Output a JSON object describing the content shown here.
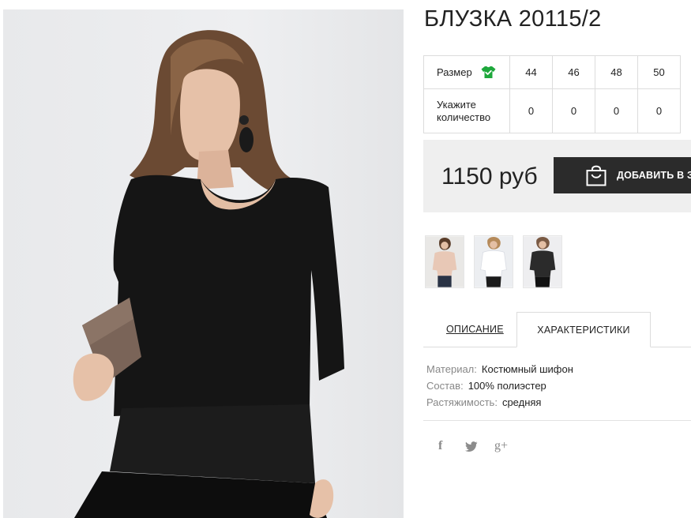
{
  "product": {
    "title": "БЛУЗКА 20115/2",
    "photo_alt": "Black blouse product photo"
  },
  "size_table": {
    "size_label": "Размер",
    "qty_label_line1": "Укажите",
    "qty_label_line2": "количество",
    "sizes": [
      "44",
      "46",
      "48",
      "50"
    ],
    "quantities": [
      "0",
      "0",
      "0",
      "0"
    ],
    "icon": "shirt-check-icon",
    "icon_color": "#1ea83c"
  },
  "purchase": {
    "price": "1150 руб",
    "add_to_cart_label": "ДОБАВИТЬ В ЗА",
    "button_color": "#2b2b2b"
  },
  "thumbnails": [
    {
      "color": "beige"
    },
    {
      "color": "white"
    },
    {
      "color": "black"
    }
  ],
  "tabs": {
    "description": "ОПИСАНИЕ",
    "characteristics": "ХАРАКТЕРИСТИКИ",
    "active": "characteristics"
  },
  "characteristics": [
    {
      "key": "Материал:",
      "value": "Костюмный шифон"
    },
    {
      "key": "Состав:",
      "value": "100% полиэстер"
    },
    {
      "key": "Растяжимость:",
      "value": "средняя"
    }
  ],
  "social": {
    "facebook": "f",
    "twitter": "t",
    "google_plus": "g+"
  }
}
